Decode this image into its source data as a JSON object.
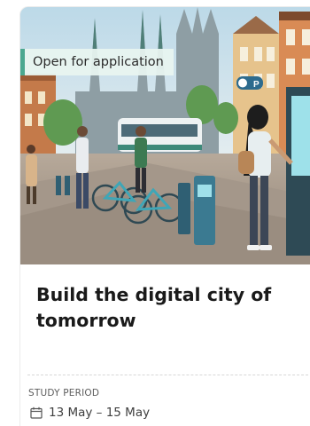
{
  "card": {
    "status_badge": "Open for application",
    "title": "Build the digital city of tomorrow",
    "study_period_label": "STUDY PERIOD",
    "study_period_dates": "13 May – 15 May",
    "calendar_icon": "calendar-icon",
    "accent_color": "#4ba890",
    "image_alt": "illustrated city street with tram, bike share station and people using digital kiosks"
  },
  "sign": {
    "parking": "P"
  }
}
